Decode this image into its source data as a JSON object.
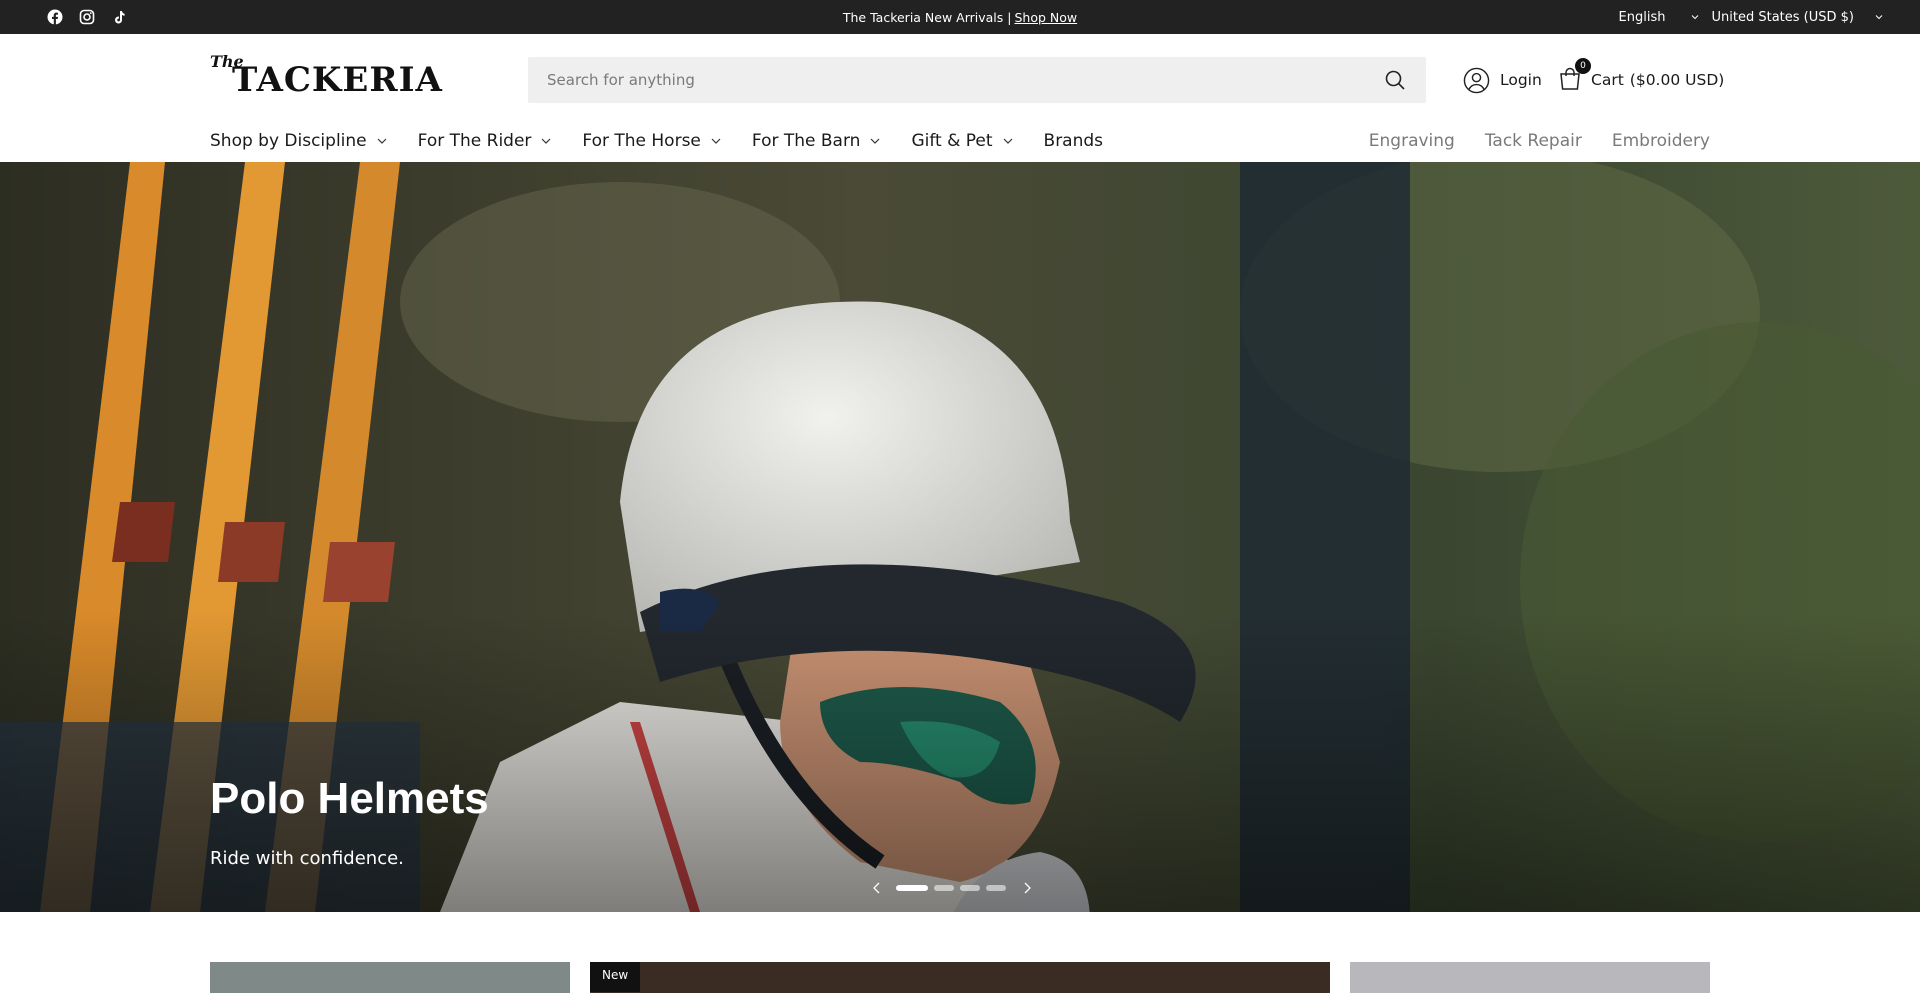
{
  "topbar": {
    "social": [
      "facebook-icon",
      "instagram-icon",
      "tiktok-icon"
    ],
    "announcement_text": "The Tackeria New Arrivals |",
    "announcement_link": "Shop Now",
    "language": "English",
    "country": "United States (USD $)"
  },
  "header": {
    "logo_the": "The",
    "logo_word": "TACKERIA",
    "search_placeholder": "Search for anything",
    "login_label": "Login",
    "cart_count": "0",
    "cart_label": "Cart",
    "cart_total": "($0.00 USD)"
  },
  "nav": {
    "items": [
      {
        "label": "Shop by Discipline",
        "dropdown": true
      },
      {
        "label": "For The Rider",
        "dropdown": true
      },
      {
        "label": "For The Horse",
        "dropdown": true
      },
      {
        "label": "For The Barn",
        "dropdown": true
      },
      {
        "label": "Gift & Pet",
        "dropdown": true
      },
      {
        "label": "Brands",
        "dropdown": false
      }
    ],
    "secondary": [
      "Engraving",
      "Tack Repair",
      "Embroidery"
    ]
  },
  "hero": {
    "title": "Polo Helmets",
    "subtitle": "Ride with confidence.",
    "slides": 4,
    "active_slide": 1
  },
  "cards": {
    "badge": "New"
  },
  "colors": {
    "topbar": "#222222",
    "search_bg": "#efefef",
    "muted_nav": "#7a7a7a"
  }
}
